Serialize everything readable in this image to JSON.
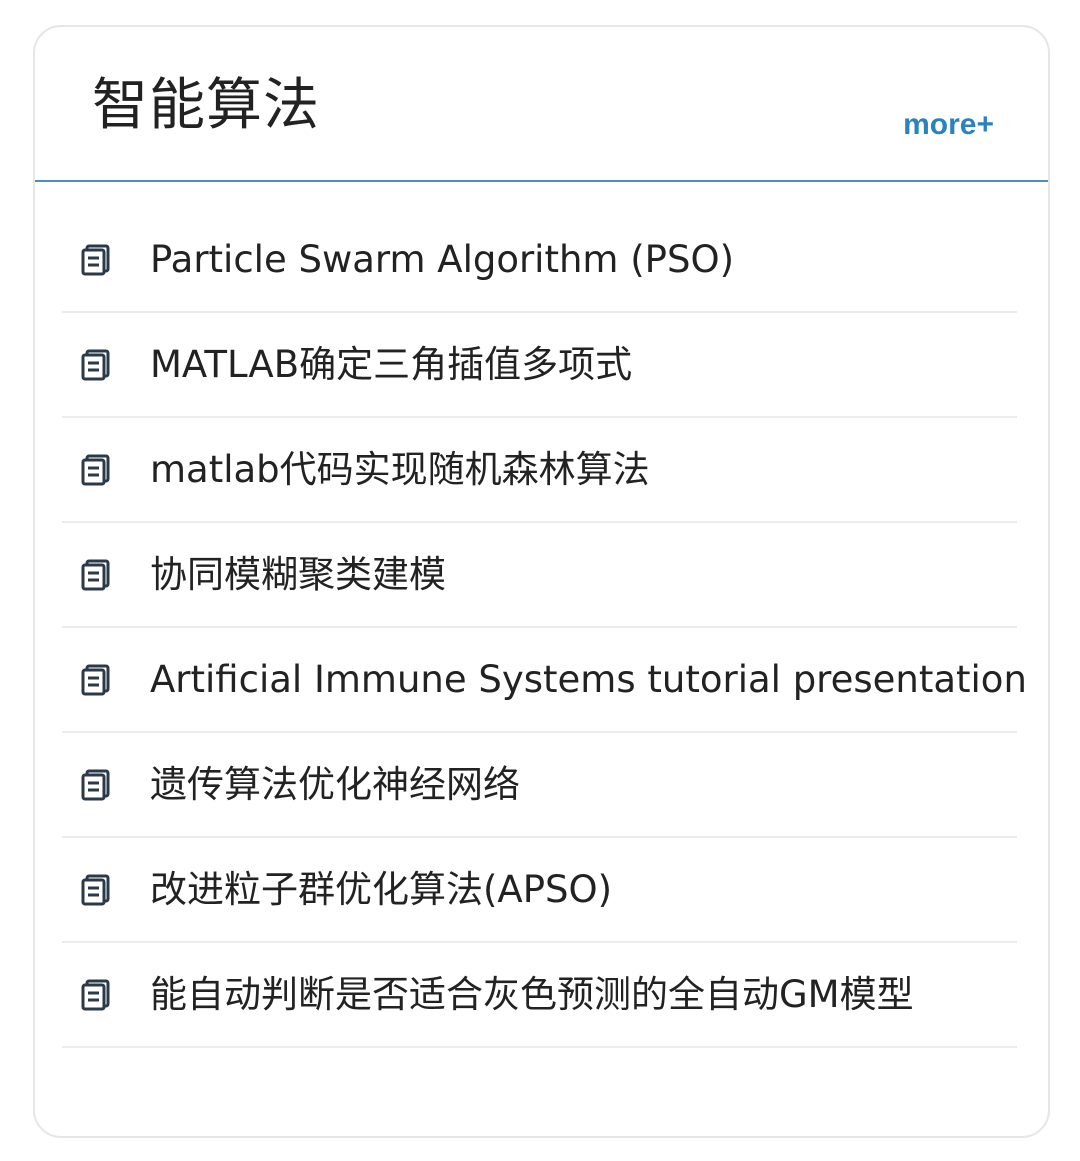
{
  "panel": {
    "title": "智能算法",
    "more_label": "more+",
    "accent_color": "#4a90b8",
    "link_color": "#2a82bf",
    "item_icon": "document-icon",
    "items": [
      {
        "label": "Particle Swarm Algorithm (PSO)"
      },
      {
        "label": "MATLAB确定三角插值多项式"
      },
      {
        "label": "matlab代码实现随机森林算法"
      },
      {
        "label": "协同模糊聚类建模"
      },
      {
        "label": "Artificial Immune Systems tutorial presentation"
      },
      {
        "label": "遗传算法优化神经网络"
      },
      {
        "label": "改进粒子群优化算法(APSO)"
      },
      {
        "label": "能自动判断是否适合灰色预测的全自动GM模型"
      }
    ]
  }
}
